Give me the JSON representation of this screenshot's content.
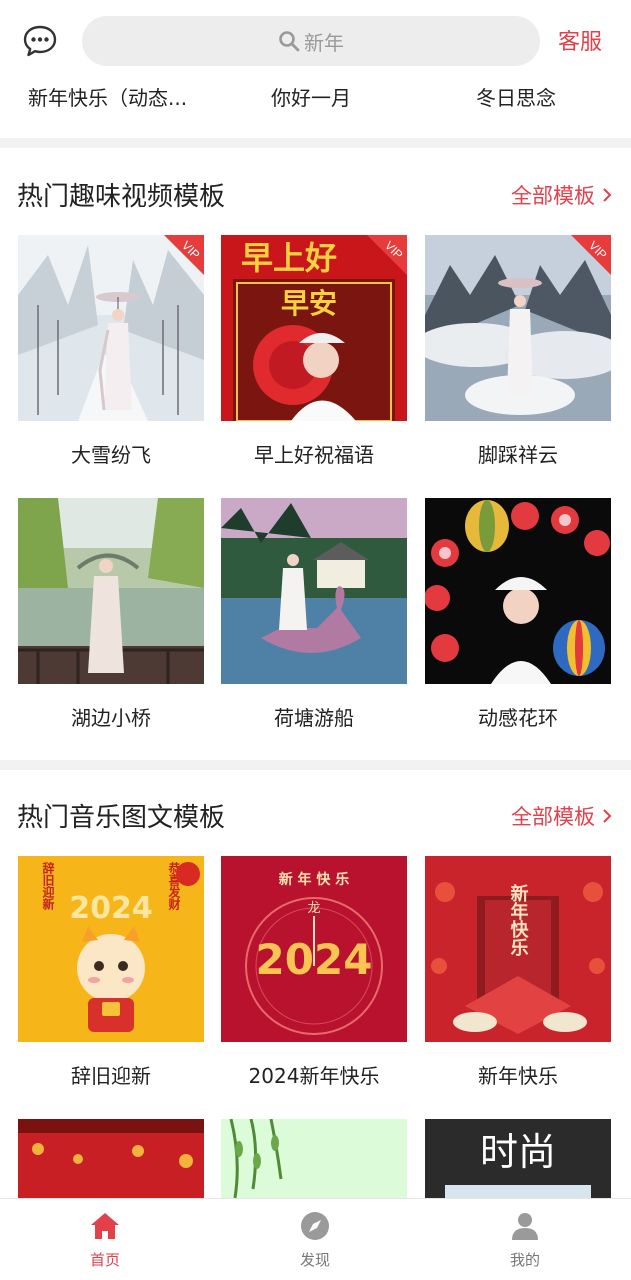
{
  "header": {
    "search_placeholder": "新年",
    "service_label": "客服"
  },
  "prev_row": [
    "新年快乐（动态...",
    "你好一月",
    "冬日思念"
  ],
  "video_section": {
    "title": "热门趣味视频模板",
    "more_label": "全部模板",
    "items": [
      {
        "label": "大雪纷飞",
        "vip": true
      },
      {
        "label": "早上好祝福语",
        "vip": true,
        "overlay_text_1": "早上好",
        "overlay_text_2": "早安"
      },
      {
        "label": "脚踩祥云",
        "vip": true
      },
      {
        "label": "湖边小桥",
        "vip": false
      },
      {
        "label": "荷塘游船",
        "vip": false
      },
      {
        "label": "动感花环",
        "vip": false
      }
    ],
    "vip_badge": "VIP"
  },
  "music_section": {
    "title": "热门音乐图文模板",
    "more_label": "全部模板",
    "items": [
      {
        "label": "辞旧迎新",
        "year": "2024",
        "left_text": "辞旧迎新",
        "right_text": "恭喜发财"
      },
      {
        "label": "2024新年快乐",
        "year": "2024",
        "top_text": "新 年 快 乐",
        "dragon": "龙"
      },
      {
        "label": "新年快乐",
        "vertical_text": "新年快乐"
      }
    ],
    "partial_items": [
      {
        "label": ""
      },
      {
        "label": ""
      },
      {
        "label": "",
        "overlay_text": "时尚"
      }
    ]
  },
  "bottom_nav": [
    {
      "label": "首页",
      "icon": "home-icon",
      "active": true
    },
    {
      "label": "发现",
      "icon": "compass-icon",
      "active": false
    },
    {
      "label": "我的",
      "icon": "user-icon",
      "active": false
    }
  ],
  "colors": {
    "accent": "#e2404a",
    "divider": "#f2f2f2"
  }
}
